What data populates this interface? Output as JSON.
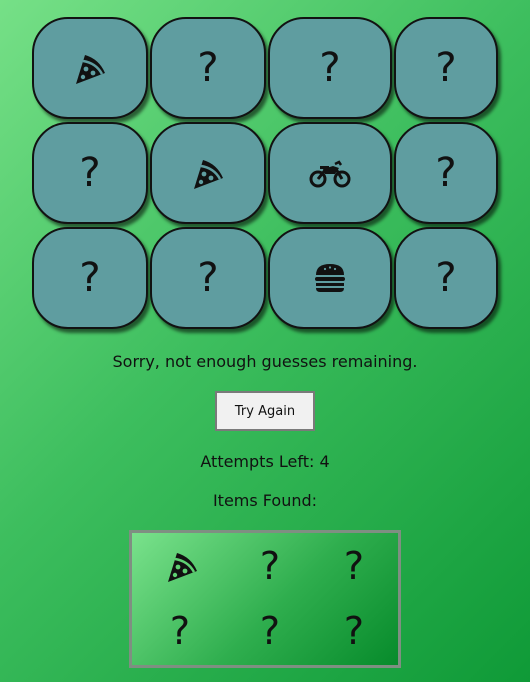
{
  "grid": {
    "cards": [
      {
        "state": "revealed",
        "icon": "pizza-icon",
        "text": ""
      },
      {
        "state": "hidden",
        "icon": "",
        "text": "?"
      },
      {
        "state": "hidden",
        "icon": "",
        "text": "?"
      },
      {
        "state": "hidden",
        "icon": "",
        "text": "?"
      },
      {
        "state": "hidden",
        "icon": "",
        "text": "?"
      },
      {
        "state": "revealed",
        "icon": "pizza-icon",
        "text": ""
      },
      {
        "state": "revealed",
        "icon": "motorcycle-icon",
        "text": ""
      },
      {
        "state": "hidden",
        "icon": "",
        "text": "?"
      },
      {
        "state": "hidden",
        "icon": "",
        "text": "?"
      },
      {
        "state": "hidden",
        "icon": "",
        "text": "?"
      },
      {
        "state": "revealed",
        "icon": "burger-icon",
        "text": ""
      },
      {
        "state": "hidden",
        "icon": "",
        "text": "?"
      }
    ]
  },
  "status": {
    "message": "Sorry, not enough guesses remaining.",
    "button_label": "Try Again",
    "attempts": "Attempts Left: 4",
    "items_found_label": "Items Found:"
  },
  "found": {
    "slots": [
      {
        "state": "found",
        "icon": "pizza-icon",
        "text": ""
      },
      {
        "state": "unknown",
        "icon": "",
        "text": "?"
      },
      {
        "state": "unknown",
        "icon": "",
        "text": "?"
      },
      {
        "state": "unknown",
        "icon": "",
        "text": "?"
      },
      {
        "state": "unknown",
        "icon": "",
        "text": "?"
      },
      {
        "state": "unknown",
        "icon": "",
        "text": "?"
      }
    ]
  },
  "colors": {
    "card": "#5f9da0",
    "background_light": "#76e087",
    "background_dark": "#0f9a37"
  }
}
